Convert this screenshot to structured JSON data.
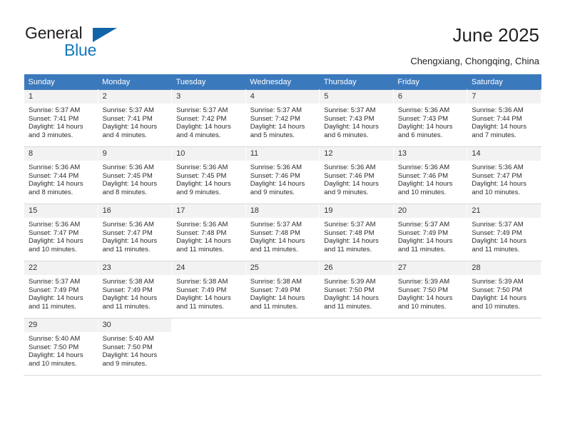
{
  "brand": {
    "name_part1": "General",
    "name_part2": "Blue",
    "triangle_icon": "triangle-icon"
  },
  "header": {
    "title": "June 2025",
    "subtitle": "Chengxiang, Chongqing, China"
  },
  "colors": {
    "header_blue": "#3b79bd",
    "brand_blue": "#1278be",
    "triangle_blue": "#1064a8",
    "daynum_bg": "#f2f2f2",
    "cell_border_top": "#4a7ebb"
  },
  "calendar": {
    "weekday_headers": [
      "Sunday",
      "Monday",
      "Tuesday",
      "Wednesday",
      "Thursday",
      "Friday",
      "Saturday"
    ],
    "weeks": [
      [
        {
          "day": "1",
          "sunrise": "Sunrise: 5:37 AM",
          "sunset": "Sunset: 7:41 PM",
          "daylight1": "Daylight: 14 hours",
          "daylight2": "and 3 minutes."
        },
        {
          "day": "2",
          "sunrise": "Sunrise: 5:37 AM",
          "sunset": "Sunset: 7:41 PM",
          "daylight1": "Daylight: 14 hours",
          "daylight2": "and 4 minutes."
        },
        {
          "day": "3",
          "sunrise": "Sunrise: 5:37 AM",
          "sunset": "Sunset: 7:42 PM",
          "daylight1": "Daylight: 14 hours",
          "daylight2": "and 4 minutes."
        },
        {
          "day": "4",
          "sunrise": "Sunrise: 5:37 AM",
          "sunset": "Sunset: 7:42 PM",
          "daylight1": "Daylight: 14 hours",
          "daylight2": "and 5 minutes."
        },
        {
          "day": "5",
          "sunrise": "Sunrise: 5:37 AM",
          "sunset": "Sunset: 7:43 PM",
          "daylight1": "Daylight: 14 hours",
          "daylight2": "and 6 minutes."
        },
        {
          "day": "6",
          "sunrise": "Sunrise: 5:36 AM",
          "sunset": "Sunset: 7:43 PM",
          "daylight1": "Daylight: 14 hours",
          "daylight2": "and 6 minutes."
        },
        {
          "day": "7",
          "sunrise": "Sunrise: 5:36 AM",
          "sunset": "Sunset: 7:44 PM",
          "daylight1": "Daylight: 14 hours",
          "daylight2": "and 7 minutes."
        }
      ],
      [
        {
          "day": "8",
          "sunrise": "Sunrise: 5:36 AM",
          "sunset": "Sunset: 7:44 PM",
          "daylight1": "Daylight: 14 hours",
          "daylight2": "and 8 minutes."
        },
        {
          "day": "9",
          "sunrise": "Sunrise: 5:36 AM",
          "sunset": "Sunset: 7:45 PM",
          "daylight1": "Daylight: 14 hours",
          "daylight2": "and 8 minutes."
        },
        {
          "day": "10",
          "sunrise": "Sunrise: 5:36 AM",
          "sunset": "Sunset: 7:45 PM",
          "daylight1": "Daylight: 14 hours",
          "daylight2": "and 9 minutes."
        },
        {
          "day": "11",
          "sunrise": "Sunrise: 5:36 AM",
          "sunset": "Sunset: 7:46 PM",
          "daylight1": "Daylight: 14 hours",
          "daylight2": "and 9 minutes."
        },
        {
          "day": "12",
          "sunrise": "Sunrise: 5:36 AM",
          "sunset": "Sunset: 7:46 PM",
          "daylight1": "Daylight: 14 hours",
          "daylight2": "and 9 minutes."
        },
        {
          "day": "13",
          "sunrise": "Sunrise: 5:36 AM",
          "sunset": "Sunset: 7:46 PM",
          "daylight1": "Daylight: 14 hours",
          "daylight2": "and 10 minutes."
        },
        {
          "day": "14",
          "sunrise": "Sunrise: 5:36 AM",
          "sunset": "Sunset: 7:47 PM",
          "daylight1": "Daylight: 14 hours",
          "daylight2": "and 10 minutes."
        }
      ],
      [
        {
          "day": "15",
          "sunrise": "Sunrise: 5:36 AM",
          "sunset": "Sunset: 7:47 PM",
          "daylight1": "Daylight: 14 hours",
          "daylight2": "and 10 minutes."
        },
        {
          "day": "16",
          "sunrise": "Sunrise: 5:36 AM",
          "sunset": "Sunset: 7:47 PM",
          "daylight1": "Daylight: 14 hours",
          "daylight2": "and 11 minutes."
        },
        {
          "day": "17",
          "sunrise": "Sunrise: 5:36 AM",
          "sunset": "Sunset: 7:48 PM",
          "daylight1": "Daylight: 14 hours",
          "daylight2": "and 11 minutes."
        },
        {
          "day": "18",
          "sunrise": "Sunrise: 5:37 AM",
          "sunset": "Sunset: 7:48 PM",
          "daylight1": "Daylight: 14 hours",
          "daylight2": "and 11 minutes."
        },
        {
          "day": "19",
          "sunrise": "Sunrise: 5:37 AM",
          "sunset": "Sunset: 7:48 PM",
          "daylight1": "Daylight: 14 hours",
          "daylight2": "and 11 minutes."
        },
        {
          "day": "20",
          "sunrise": "Sunrise: 5:37 AM",
          "sunset": "Sunset: 7:49 PM",
          "daylight1": "Daylight: 14 hours",
          "daylight2": "and 11 minutes."
        },
        {
          "day": "21",
          "sunrise": "Sunrise: 5:37 AM",
          "sunset": "Sunset: 7:49 PM",
          "daylight1": "Daylight: 14 hours",
          "daylight2": "and 11 minutes."
        }
      ],
      [
        {
          "day": "22",
          "sunrise": "Sunrise: 5:37 AM",
          "sunset": "Sunset: 7:49 PM",
          "daylight1": "Daylight: 14 hours",
          "daylight2": "and 11 minutes."
        },
        {
          "day": "23",
          "sunrise": "Sunrise: 5:38 AM",
          "sunset": "Sunset: 7:49 PM",
          "daylight1": "Daylight: 14 hours",
          "daylight2": "and 11 minutes."
        },
        {
          "day": "24",
          "sunrise": "Sunrise: 5:38 AM",
          "sunset": "Sunset: 7:49 PM",
          "daylight1": "Daylight: 14 hours",
          "daylight2": "and 11 minutes."
        },
        {
          "day": "25",
          "sunrise": "Sunrise: 5:38 AM",
          "sunset": "Sunset: 7:49 PM",
          "daylight1": "Daylight: 14 hours",
          "daylight2": "and 11 minutes."
        },
        {
          "day": "26",
          "sunrise": "Sunrise: 5:39 AM",
          "sunset": "Sunset: 7:50 PM",
          "daylight1": "Daylight: 14 hours",
          "daylight2": "and 11 minutes."
        },
        {
          "day": "27",
          "sunrise": "Sunrise: 5:39 AM",
          "sunset": "Sunset: 7:50 PM",
          "daylight1": "Daylight: 14 hours",
          "daylight2": "and 10 minutes."
        },
        {
          "day": "28",
          "sunrise": "Sunrise: 5:39 AM",
          "sunset": "Sunset: 7:50 PM",
          "daylight1": "Daylight: 14 hours",
          "daylight2": "and 10 minutes."
        }
      ],
      [
        {
          "day": "29",
          "sunrise": "Sunrise: 5:40 AM",
          "sunset": "Sunset: 7:50 PM",
          "daylight1": "Daylight: 14 hours",
          "daylight2": "and 10 minutes."
        },
        {
          "day": "30",
          "sunrise": "Sunrise: 5:40 AM",
          "sunset": "Sunset: 7:50 PM",
          "daylight1": "Daylight: 14 hours",
          "daylight2": "and 9 minutes."
        },
        null,
        null,
        null,
        null,
        null
      ]
    ]
  }
}
